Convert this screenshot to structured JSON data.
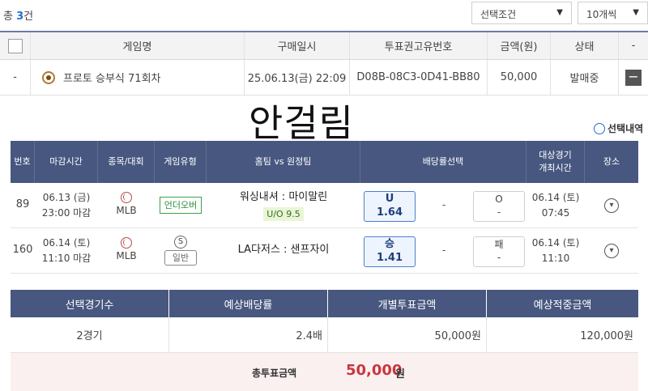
{
  "header": {
    "total_prefix": "총 ",
    "total_count": "3",
    "total_suffix": "건",
    "filter_select": "선택조건",
    "page_size_select": "10개씩"
  },
  "ticket_table": {
    "columns": [
      "게임명",
      "구매일시",
      "투표권고유번호",
      "금액(원)",
      "상태",
      "-"
    ],
    "row": {
      "index": "-",
      "game_name": "프로토 승부식 71회차",
      "purchase_datetime": "25.06.13(금) 22:09",
      "ticket_id": "D08B-08C3-0D41-BB80",
      "amount": "50,000",
      "status": "발매중",
      "action": "−"
    }
  },
  "overlay_text": "안걸림",
  "select_history_label": "선택내역",
  "game_table": {
    "columns": [
      "번호",
      "마감시간",
      "종목/대회",
      "게임유형",
      "홈팀 vs 원정팀",
      "배당률선택",
      "대상경기\n개최시간",
      "장소"
    ],
    "rows": [
      {
        "no": "89",
        "deadline_date": "06.13 (금)",
        "deadline_time": "23:00 마감",
        "league": "MLB",
        "game_type": "언더오버",
        "matchup": "워싱내셔 : 마이말린",
        "uo_line": "U/O 9.5",
        "odds_selected_label": "U",
        "odds_selected_value": "1.64",
        "odds_mid": "-",
        "odds_other_label": "O",
        "odds_other_value": "-",
        "game_date": "06.14 (토)",
        "game_time": "07:45"
      },
      {
        "no": "160",
        "deadline_date": "06.14 (토)",
        "deadline_time": "11:10 마감",
        "league": "MLB",
        "game_type_icon": "S",
        "game_type": "일반",
        "matchup": "LA다저스 : 샌프자이",
        "odds_selected_label": "승",
        "odds_selected_value": "1.41",
        "odds_mid": "-",
        "odds_other_label": "패",
        "odds_other_value": "-",
        "game_date": "06.14 (토)",
        "game_time": "11:10"
      }
    ]
  },
  "summary": {
    "columns": [
      "선택경기수",
      "예상배당률",
      "개별투표금액",
      "예상적중금액"
    ],
    "values": [
      "2경기",
      "2.4배",
      "50,000원",
      "120,000원"
    ],
    "total_label": "총투표금액",
    "total_amount": "50,000",
    "total_unit": "원"
  },
  "colors": {
    "header_navy": "#47577f",
    "accent_blue": "#1f6fd0",
    "total_red": "#c8373f",
    "tag_green": "#3aa34a"
  }
}
